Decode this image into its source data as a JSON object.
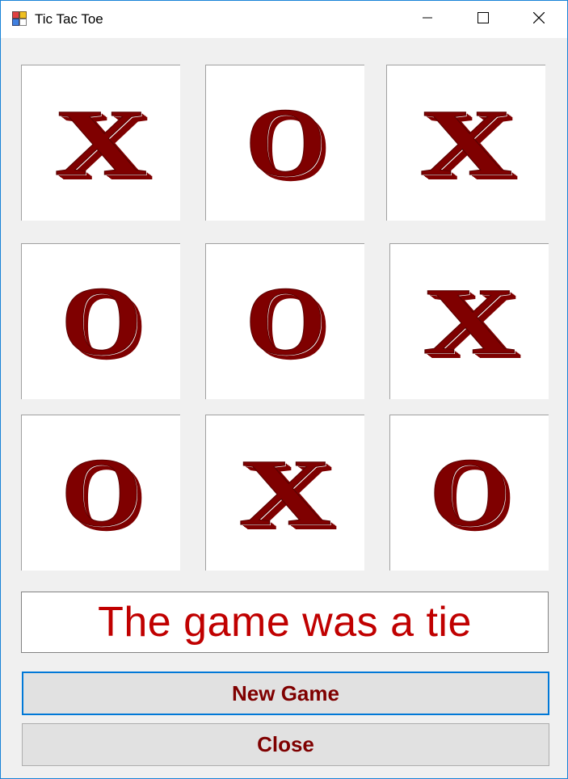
{
  "window": {
    "title": "Tic Tac Toe",
    "icons": {
      "app": "app-icon",
      "minimize": "minimize-icon",
      "maximize": "maximize-icon",
      "close": "close-icon"
    }
  },
  "board": {
    "cells": [
      "X",
      "O",
      "X",
      "O",
      "O",
      "X",
      "O",
      "X",
      "O"
    ],
    "mark_color": "#7f0000"
  },
  "status": {
    "text": "The game was a tie",
    "color": "#c00000"
  },
  "buttons": {
    "new_game": "New Game",
    "close": "Close"
  }
}
